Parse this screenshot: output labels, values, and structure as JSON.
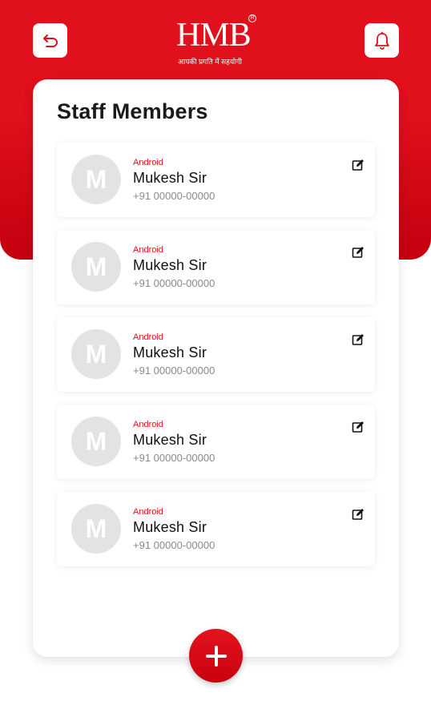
{
  "header": {
    "logo_text": "HMB",
    "logo_reg": "R",
    "logo_tagline": "आपकी प्रगति में सहयोगी",
    "back_icon": "back-arrow-icon",
    "bell_icon": "bell-icon"
  },
  "page": {
    "title": "Staff Members"
  },
  "members": [
    {
      "initial": "M",
      "platform": "Android",
      "name": "Mukesh Sir",
      "phone": "+91 00000-00000"
    },
    {
      "initial": "M",
      "platform": "Android",
      "name": "Mukesh Sir",
      "phone": "+91 00000-00000"
    },
    {
      "initial": "M",
      "platform": "Android",
      "name": "Mukesh Sir",
      "phone": "+91 00000-00000"
    },
    {
      "initial": "M",
      "platform": "Android",
      "name": "Mukesh Sir",
      "phone": "+91 00000-00000"
    },
    {
      "initial": "M",
      "platform": "Android",
      "name": "Mukesh Sir",
      "phone": "+91 00000-00000"
    }
  ],
  "fab": {
    "icon": "plus-icon"
  },
  "colors": {
    "accent": "#e0101c",
    "avatar_bg": "#e3e3e3",
    "muted_text": "#8a8a8a"
  }
}
